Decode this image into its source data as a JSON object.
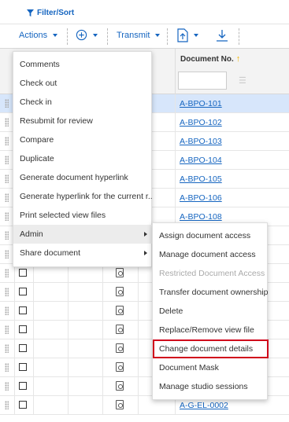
{
  "topbar": {
    "filter_label": "Filter/Sort"
  },
  "toolbar": {
    "actions_label": "Actions",
    "transmit_label": "Transmit"
  },
  "grid": {
    "doc_col_title": "Document No.",
    "rows": [
      {
        "doc": "A-BPO-101",
        "selected": true
      },
      {
        "doc": "A-BPO-102"
      },
      {
        "doc": "A-BPO-103"
      },
      {
        "doc": "A-BPO-104"
      },
      {
        "doc": "A-BPO-105"
      },
      {
        "doc": "A-BPO-106"
      },
      {
        "doc": "A-BPO-108"
      },
      {
        "doc": ""
      },
      {
        "doc": ""
      },
      {
        "doc": ""
      },
      {
        "doc": ""
      },
      {
        "doc": ""
      },
      {
        "doc": ""
      },
      {
        "doc": ""
      },
      {
        "doc": ""
      },
      {
        "doc": ""
      },
      {
        "doc": "A-G-EL-0002"
      }
    ]
  },
  "menu": {
    "items": [
      {
        "label": "Comments"
      },
      {
        "label": "Check out"
      },
      {
        "label": "Check in"
      },
      {
        "label": "Resubmit for review"
      },
      {
        "label": "Compare"
      },
      {
        "label": "Duplicate"
      },
      {
        "label": "Generate document hyperlink"
      },
      {
        "label": "Generate hyperlink for the current r..."
      },
      {
        "label": "Print selected view files"
      },
      {
        "label": "Admin",
        "submenu": true,
        "highlighted": true
      },
      {
        "label": "Share document",
        "submenu": true
      }
    ]
  },
  "submenu": {
    "items": [
      {
        "label": "Assign document access"
      },
      {
        "label": "Manage document access"
      },
      {
        "label": "Restricted Document Access",
        "disabled": true
      },
      {
        "label": "Transfer document ownership"
      },
      {
        "label": "Delete"
      },
      {
        "label": "Replace/Remove view file"
      },
      {
        "label": "Change document details",
        "boxed": true
      },
      {
        "label": "Document Mask"
      },
      {
        "label": "Manage studio sessions"
      }
    ]
  },
  "colors": {
    "accent": "#1565c0",
    "highlight_box": "#d0021b",
    "selected_row": "#d7e6fb"
  }
}
